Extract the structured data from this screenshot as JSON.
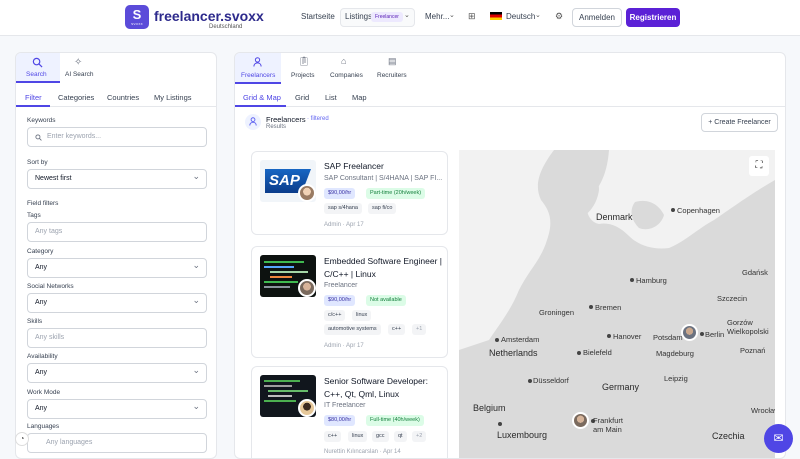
{
  "header": {
    "logo_letter": "S",
    "logo_small": "SVOXX",
    "brand": "freelancer.svoxx",
    "brand_sub": "Deutschland",
    "nav_home": "Startseite",
    "nav_listings": "Listings",
    "nav_listings_badge": "Freelancer",
    "nav_more": "Mehr...",
    "language": "Deutsch",
    "login": "Anmelden",
    "register": "Registrieren"
  },
  "left": {
    "tabs": [
      {
        "label": "Search",
        "icon": "search-icon"
      },
      {
        "label": "AI Search",
        "icon": "sparkles-icon"
      }
    ],
    "subtabs": [
      "Filter",
      "Categories",
      "Countries",
      "My Listings"
    ],
    "keywords_label": "Keywords",
    "keywords_placeholder": "Enter keywords...",
    "sort_label": "Sort by",
    "sort_value": "Newest first",
    "field_filters": "Field filters",
    "tags_label": "Tags",
    "tags_placeholder": "Any tags",
    "category_label": "Category",
    "category_value": "Any",
    "social_label": "Social Networks",
    "social_value": "Any",
    "skills_label": "Skills",
    "skills_placeholder": "Any skills",
    "availability_label": "Availability",
    "availability_value": "Any",
    "workmode_label": "Work Mode",
    "workmode_value": "Any",
    "languages_label": "Languages",
    "languages_placeholder": "Any languages"
  },
  "right": {
    "tabs": [
      {
        "label": "Freelancers",
        "icon": "user-icon"
      },
      {
        "label": "Projects",
        "icon": "clipboard-icon"
      },
      {
        "label": "Companies",
        "icon": "building-icon"
      },
      {
        "label": "Recruiters",
        "icon": "document-icon"
      }
    ],
    "views": [
      "Grid & Map",
      "Grid",
      "List",
      "Map"
    ],
    "results_title": "Freelancers",
    "results_filtered": "· filtered",
    "results_sub": "Results",
    "create_button": "+ Create Freelancer"
  },
  "cards": [
    {
      "title": "SAP Freelancer",
      "subtitle": "SAP Consultant | S/4HANA | SAP FI...",
      "rate": "$90,00/hr",
      "status": "Part-time (20h/week)",
      "skills": [
        "sap s/4hana",
        "sap fi/co"
      ],
      "footer": "Admin · Apr 17",
      "thumb_text": "SAP"
    },
    {
      "title": "Embedded Software Engineer | C/C++ | Linux",
      "subtitle": "Freelancer",
      "rate": "$90,00/hr",
      "status": "Not available",
      "skills": [
        "c/c++",
        "linux",
        "automotive systems",
        "c++",
        "+1"
      ],
      "footer": "Admin · Apr 17"
    },
    {
      "title": "Senior Software Developer: C++, Qt, Qml, Linux",
      "subtitle": "IT Freelancer",
      "rate": "$80,00/hr",
      "status": "Full-time (40h/week)",
      "skills": [
        "c++",
        "linux",
        "gcc",
        "qt",
        "+2"
      ],
      "footer": "Nurettin Kılıncarslan · Apr 14"
    }
  ],
  "map": {
    "cities": [
      "Denmark",
      "Copenhagen",
      "Gdańsk",
      "Hamburg",
      "Szczecin",
      "Bremen",
      "Groningen",
      "Gorzów Wielkopolski",
      "Amsterdam",
      "Netherlands",
      "Hanover",
      "Potsdam",
      "Berlin",
      "Bielefeld",
      "Magdeburg",
      "Poznań",
      "Düsseldorf",
      "Leipzig",
      "Germany",
      "Belgium",
      "Frankfurt am Main",
      "Luxembourg",
      "Czechia",
      "Wrocław"
    ],
    "colors": {
      "land": "#dadada",
      "water": "#f2f2f2"
    }
  },
  "colors": {
    "accent": "#5b21d6",
    "brand": "#2d2a8c"
  }
}
